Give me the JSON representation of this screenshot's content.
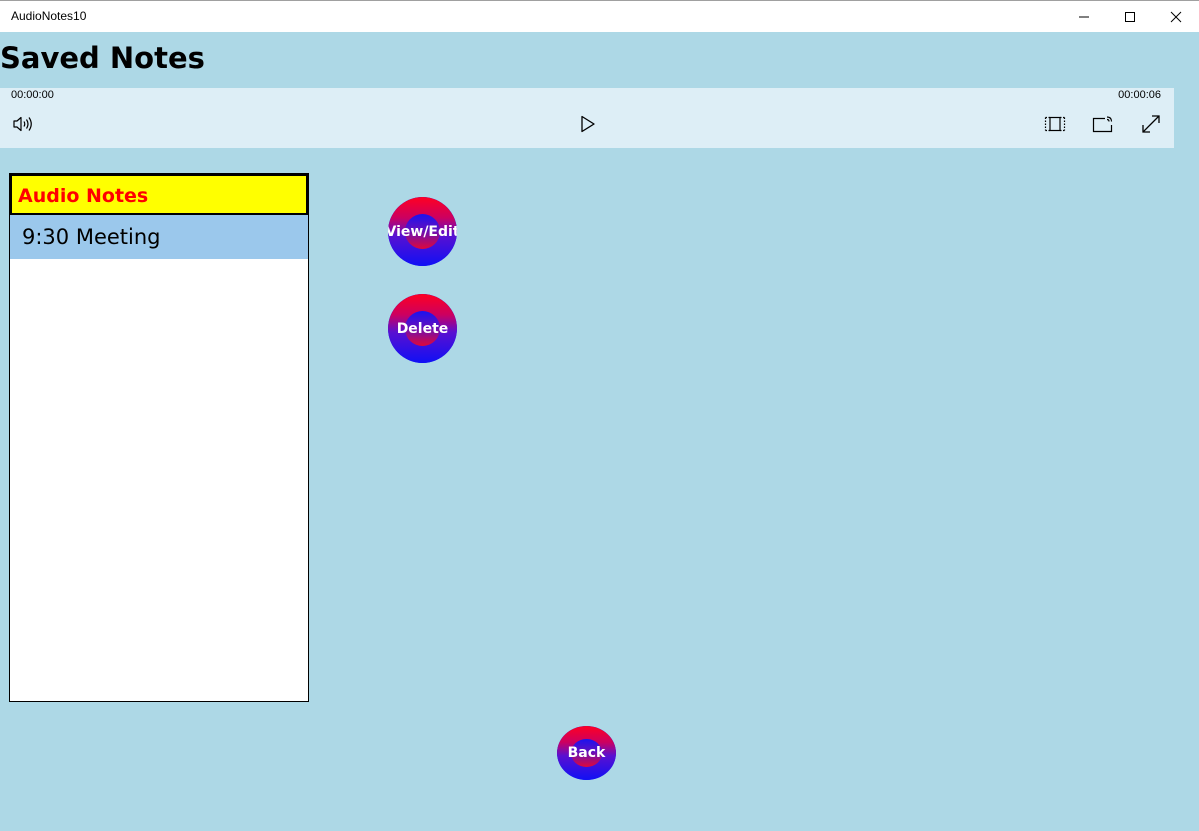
{
  "window": {
    "title": "AudioNotes10",
    "minimize_icon": "minimize-icon",
    "maximize_icon": "maximize-icon",
    "close_icon": "close-icon"
  },
  "page": {
    "title": "Saved Notes"
  },
  "media_player": {
    "time_elapsed": "00:00:00",
    "time_remaining": "00:00:06",
    "controls": [
      "volume-icon",
      "play-icon",
      "aspect-ratio-icon",
      "cast-icon",
      "fullscreen-icon"
    ]
  },
  "notes_list": {
    "header": "Audio Notes",
    "header_bg": "#ffff00",
    "header_color": "#ff0000",
    "items": [
      {
        "label": "9:30 Meeting",
        "selected": true
      }
    ],
    "selected_bg": "#9bc8ec"
  },
  "actions": {
    "view_edit_label": "View/Edit",
    "delete_label": "Delete",
    "back_label": "Back"
  },
  "colors": {
    "background": "#add8e6",
    "media_bar": "#ddeef6"
  }
}
